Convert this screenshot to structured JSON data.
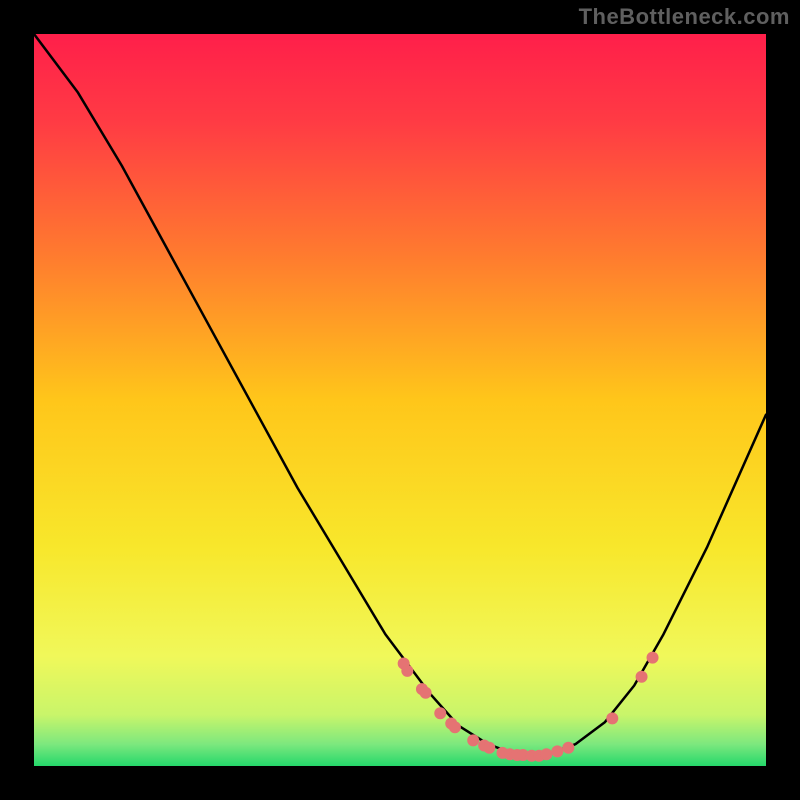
{
  "watermark": "TheBottleneck.com",
  "chart_data": {
    "type": "line",
    "title": "",
    "xlabel": "",
    "ylabel": "",
    "xlim": [
      0,
      1
    ],
    "ylim": [
      0,
      1
    ],
    "background": {
      "gradient_stops": [
        {
          "offset": 0.0,
          "color": "#ff1f4a"
        },
        {
          "offset": 0.12,
          "color": "#ff3b44"
        },
        {
          "offset": 0.3,
          "color": "#ff7a2f"
        },
        {
          "offset": 0.5,
          "color": "#ffc61a"
        },
        {
          "offset": 0.7,
          "color": "#f8e72b"
        },
        {
          "offset": 0.85,
          "color": "#f0f85a"
        },
        {
          "offset": 0.93,
          "color": "#c9f56a"
        },
        {
          "offset": 0.97,
          "color": "#7de87e"
        },
        {
          "offset": 1.0,
          "color": "#25d86b"
        }
      ]
    },
    "series": [
      {
        "name": "curve",
        "x": [
          0.0,
          0.06,
          0.12,
          0.18,
          0.24,
          0.3,
          0.36,
          0.42,
          0.48,
          0.54,
          0.58,
          0.62,
          0.66,
          0.7,
          0.74,
          0.78,
          0.82,
          0.86,
          0.92,
          1.0
        ],
        "y": [
          0.0,
          0.08,
          0.18,
          0.29,
          0.4,
          0.51,
          0.62,
          0.72,
          0.82,
          0.9,
          0.945,
          0.97,
          0.985,
          0.985,
          0.97,
          0.94,
          0.89,
          0.82,
          0.7,
          0.52
        ],
        "stroke": "#000000",
        "stroke_width": 2.5
      }
    ],
    "markers": {
      "color": "#e57373",
      "radius": 6,
      "points": [
        {
          "x": 0.505,
          "y": 0.86
        },
        {
          "x": 0.51,
          "y": 0.87
        },
        {
          "x": 0.53,
          "y": 0.895
        },
        {
          "x": 0.535,
          "y": 0.9
        },
        {
          "x": 0.555,
          "y": 0.928
        },
        {
          "x": 0.57,
          "y": 0.942
        },
        {
          "x": 0.575,
          "y": 0.947
        },
        {
          "x": 0.6,
          "y": 0.965
        },
        {
          "x": 0.615,
          "y": 0.972
        },
        {
          "x": 0.622,
          "y": 0.975
        },
        {
          "x": 0.64,
          "y": 0.982
        },
        {
          "x": 0.65,
          "y": 0.984
        },
        {
          "x": 0.66,
          "y": 0.985
        },
        {
          "x": 0.668,
          "y": 0.985
        },
        {
          "x": 0.68,
          "y": 0.986
        },
        {
          "x": 0.69,
          "y": 0.986
        },
        {
          "x": 0.7,
          "y": 0.984
        },
        {
          "x": 0.715,
          "y": 0.98
        },
        {
          "x": 0.73,
          "y": 0.975
        },
        {
          "x": 0.79,
          "y": 0.935
        },
        {
          "x": 0.83,
          "y": 0.878
        },
        {
          "x": 0.845,
          "y": 0.852
        }
      ]
    }
  }
}
